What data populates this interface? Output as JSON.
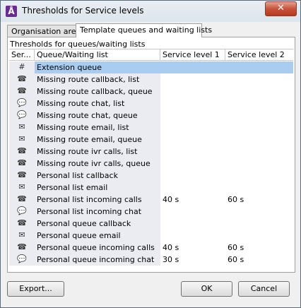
{
  "window": {
    "title": "Thresholds for Service levels",
    "app_icon_glyph": "Å",
    "close_glyph": "✕"
  },
  "tabs": [
    {
      "label": "Organisation area",
      "active": false
    },
    {
      "label": "Template queues and waiting lists",
      "active": true
    }
  ],
  "group_label": "Thresholds for queues/waiting lists",
  "table": {
    "columns": [
      "Ser...",
      "Queue/Waiting list",
      "Service level 1",
      "Service level 2"
    ],
    "rows": [
      {
        "icon": "hash-icon",
        "glyph": "#",
        "name": "Extension queue",
        "sl1": "",
        "sl2": "",
        "selected": true
      },
      {
        "icon": "phone-callback-list-icon",
        "glyph": "☎",
        "name": "Missing route callback, list",
        "sl1": "",
        "sl2": ""
      },
      {
        "icon": "phone-callback-queue-icon",
        "glyph": "☎",
        "name": "Missing route callback, queue",
        "sl1": "",
        "sl2": ""
      },
      {
        "icon": "chat-list-icon",
        "glyph": "💬",
        "name": "Missing route chat, list",
        "sl1": "",
        "sl2": ""
      },
      {
        "icon": "chat-queue-icon",
        "glyph": "💬",
        "name": "Missing route chat, queue",
        "sl1": "",
        "sl2": ""
      },
      {
        "icon": "email-list-icon",
        "glyph": "✉",
        "name": "Missing route email, list",
        "sl1": "",
        "sl2": ""
      },
      {
        "icon": "email-queue-icon",
        "glyph": "✉",
        "name": "Missing route email, queue",
        "sl1": "",
        "sl2": ""
      },
      {
        "icon": "ivr-list-icon",
        "glyph": "☎",
        "name": "Missing route ivr calls, list",
        "sl1": "",
        "sl2": ""
      },
      {
        "icon": "ivr-queue-icon",
        "glyph": "☎",
        "name": "Missing route ivr calls, queue",
        "sl1": "",
        "sl2": ""
      },
      {
        "icon": "phone-callback-list-icon",
        "glyph": "☎",
        "name": "Personal list callback",
        "sl1": "",
        "sl2": ""
      },
      {
        "icon": "email-list-icon",
        "glyph": "✉",
        "name": "Personal list email",
        "sl1": "",
        "sl2": ""
      },
      {
        "icon": "phone-list-icon",
        "glyph": "☎",
        "name": "Personal list incoming calls",
        "sl1": "40 s",
        "sl2": "60 s"
      },
      {
        "icon": "chat-list-icon",
        "glyph": "💬",
        "name": "Personal list incoming chat",
        "sl1": "",
        "sl2": ""
      },
      {
        "icon": "phone-callback-queue-icon",
        "glyph": "☎",
        "name": "Personal queue callback",
        "sl1": "",
        "sl2": ""
      },
      {
        "icon": "email-queue-icon",
        "glyph": "✉",
        "name": "Personal queue email",
        "sl1": "",
        "sl2": ""
      },
      {
        "icon": "phone-queue-icon",
        "glyph": "☎",
        "name": "Personal queue incoming calls",
        "sl1": "40 s",
        "sl2": "60 s"
      },
      {
        "icon": "chat-queue-icon",
        "glyph": "💬",
        "name": "Personal queue incoming chat",
        "sl1": "30 s",
        "sl2": "60 s"
      }
    ]
  },
  "buttons": {
    "export": "Export...",
    "ok": "OK",
    "cancel": "Cancel"
  }
}
